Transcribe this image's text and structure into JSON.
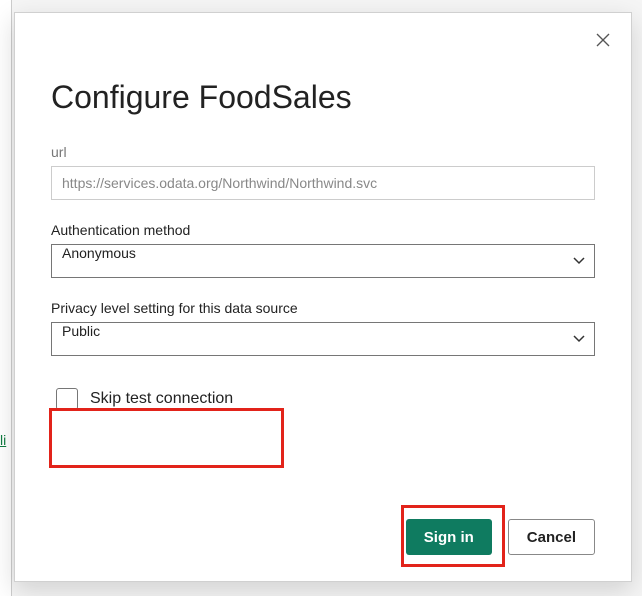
{
  "dialog": {
    "title": "Configure FoodSales",
    "url_label": "url",
    "url_value": "https://services.odata.org/Northwind/Northwind.svc",
    "auth_label": "Authentication method",
    "auth_value": "Anonymous",
    "privacy_label": "Privacy level setting for this data source",
    "privacy_value": "Public",
    "skip_test_label": "Skip test connection",
    "sign_in_label": "Sign in",
    "cancel_label": "Cancel"
  },
  "backdrop": {
    "link_fragment": "li"
  },
  "colors": {
    "primary": "#0f7b60",
    "highlight": "#e2231a"
  }
}
